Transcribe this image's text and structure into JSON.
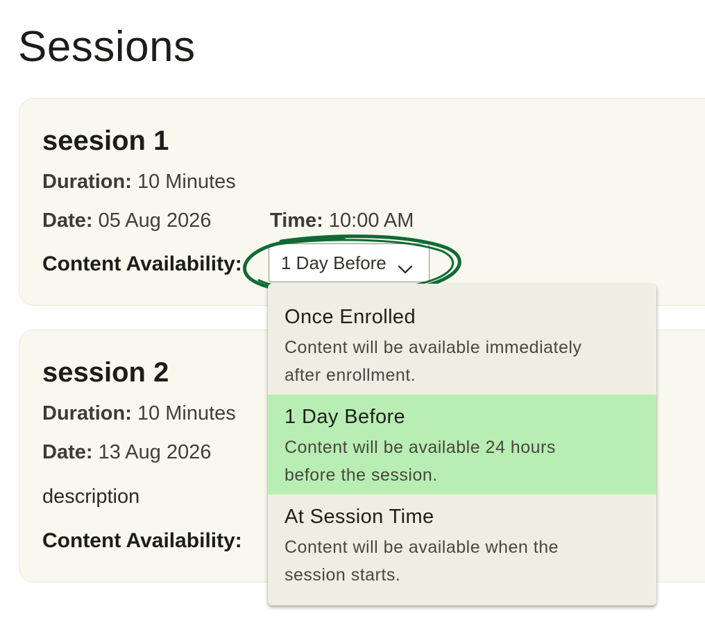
{
  "page": {
    "title": "Sessions"
  },
  "sessions": [
    {
      "name": "seesion 1",
      "duration_label": "Duration:",
      "duration_value": "10 Minutes",
      "date_label": "Date:",
      "date_value": "05 Aug 2026",
      "time_label": "Time:",
      "time_value": "10:00 AM",
      "availability_label": "Content Availability:",
      "availability_value": "1 Day Before"
    },
    {
      "name": "session 2",
      "duration_label": "Duration:",
      "duration_value": "10 Minutes",
      "date_label": "Date:",
      "date_value": "13 Aug 2026",
      "description": "description",
      "availability_label": "Content Availability:"
    }
  ],
  "dropdown": {
    "selected": "1 Day Before",
    "options": [
      {
        "title": "Once Enrolled",
        "desc_line1": "Content will be available immediately",
        "desc_line2": "after enrollment."
      },
      {
        "title": "1 Day Before",
        "desc_line1": "Content will be available 24 hours",
        "desc_line2": "before the session."
      },
      {
        "title": "At Session Time",
        "desc_line1": "Content will be available when the",
        "desc_line2": "session starts."
      }
    ]
  },
  "icons": {
    "select_chevron": "chevron-down-icon"
  },
  "colors": {
    "card_background": "#f8f8ee",
    "dropdown_background": "#eeeee3",
    "selected_option": "#b8eeb4",
    "annotation_stroke": "#0f6a35"
  }
}
